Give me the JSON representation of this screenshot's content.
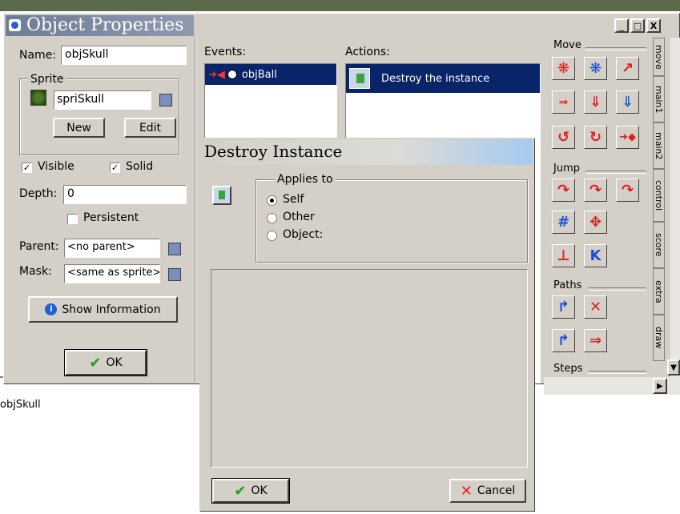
{
  "background_strip": {
    "text": "objSkull"
  },
  "object_window": {
    "title": "Object Properties",
    "name_label": "Name:",
    "name_value": "objSkull",
    "sprite_group": "Sprite",
    "sprite_value": "spriSkull",
    "new_button": "New",
    "edit_button": "Edit",
    "visible_label": "Visible",
    "solid_label": "Solid",
    "depth_label": "Depth:",
    "depth_value": "0",
    "persistent_label": "Persistent",
    "parent_label": "Parent:",
    "parent_value": "<no parent>",
    "mask_label": "Mask:",
    "mask_value": "<same as sprite>",
    "show_info_button": "Show Information",
    "ok_button": "OK",
    "events_label": "Events:",
    "events": [
      {
        "label": "objBall"
      }
    ],
    "actions_label": "Actions:",
    "actions": [
      {
        "label": "Destroy the instance"
      }
    ],
    "window_buttons": [
      "_",
      "□",
      "X"
    ]
  },
  "palette": {
    "move_label": "Move",
    "jump_label": "Jump",
    "paths_label": "Paths",
    "steps_label": "Steps",
    "tabs": [
      "move",
      "main1",
      "main2",
      "control",
      "score",
      "extra",
      "draw"
    ]
  },
  "dialog": {
    "title": "Destroy Instance",
    "applies_to_label": "Applies to",
    "options": [
      "Self",
      "Other",
      "Object:"
    ],
    "selected_option": "Self",
    "ok_button": "OK",
    "cancel_button": "Cancel"
  },
  "colors": {
    "title_active": "#0a246a",
    "title_gradient_end": "#a6caf0",
    "window_bg": "#d4d0c8",
    "selection": "#0a246a",
    "icon_red": "#e02020",
    "icon_blue": "#1a4fd6"
  }
}
